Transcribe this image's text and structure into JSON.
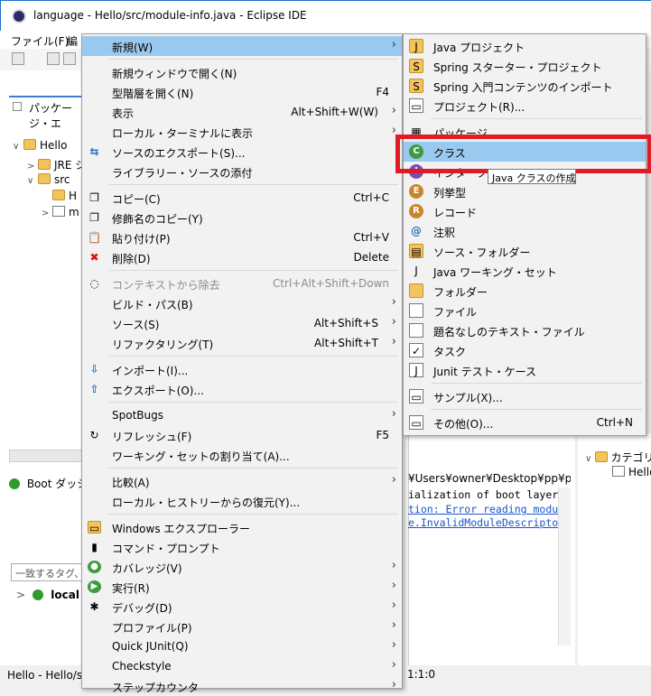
{
  "window": {
    "title": "language - Hello/src/module-info.java - Eclipse IDE"
  },
  "menubar": {
    "file": "ファイル(F)",
    "edit": "編"
  },
  "package_explorer": {
    "tab_label": "パッケージ・エ",
    "tree": [
      {
        "arrow": "∨",
        "label": "Hello"
      },
      {
        "arrow": ">",
        "label": "JRE シ"
      },
      {
        "arrow": "∨",
        "label": "src"
      },
      {
        "arrow": "",
        "label": "H"
      },
      {
        "arrow": ">",
        "label": "m"
      }
    ]
  },
  "boot_dashboard": {
    "tab_label": "Boot ダッシ",
    "filter_placeholder": "一致するタグ、",
    "local_label": "local"
  },
  "console": {
    "path": "¥Users¥owner¥Desktop¥pp¥pleiad",
    "lines": [
      "ialization of boot layer",
      "tion: Error reading modu",
      "e.InvalidModuleDescripto"
    ]
  },
  "right_panel": {
    "category": "カテゴリー",
    "item": "Hello"
  },
  "statusbar": {
    "left": "Hello - Hello/sr",
    "position": "1:1:0"
  },
  "context_menu": {
    "items": [
      {
        "label": "新規(W)",
        "shortcut": "",
        "submenu": true,
        "icon": "",
        "highlight": true
      },
      {
        "sep": true
      },
      {
        "label": "新規ウィンドウで開く(N)",
        "shortcut": "",
        "submenu": false,
        "icon": ""
      },
      {
        "label": "型階層を開く(N)",
        "shortcut": "F4",
        "submenu": false,
        "icon": ""
      },
      {
        "label": "表示",
        "shortcut": "Alt+Shift+W(W)",
        "submenu": true,
        "icon": ""
      },
      {
        "label": "ローカル・ターミナルに表示",
        "shortcut": "",
        "submenu": true,
        "icon": ""
      },
      {
        "label": "ソースのエクスポート(S)...",
        "shortcut": "",
        "submenu": false,
        "icon": "export-source-icon"
      },
      {
        "label": "ライブラリー・ソースの添付",
        "shortcut": "",
        "submenu": false,
        "icon": ""
      },
      {
        "sep": true
      },
      {
        "label": "コピー(C)",
        "shortcut": "Ctrl+C",
        "submenu": false,
        "icon": "copy-icon"
      },
      {
        "label": "修飾名のコピー(Y)",
        "shortcut": "",
        "submenu": false,
        "icon": "copy-qualified-icon"
      },
      {
        "label": "貼り付け(P)",
        "shortcut": "Ctrl+V",
        "submenu": false,
        "icon": "paste-icon"
      },
      {
        "label": "削除(D)",
        "shortcut": "Delete",
        "submenu": false,
        "icon": "delete-icon"
      },
      {
        "sep": true
      },
      {
        "label": "コンテキストから除去",
        "shortcut": "Ctrl+Alt+Shift+Down",
        "submenu": false,
        "icon": "remove-context-icon",
        "disabled": true
      },
      {
        "label": "ビルド・パス(B)",
        "shortcut": "",
        "submenu": true,
        "icon": ""
      },
      {
        "label": "ソース(S)",
        "shortcut": "Alt+Shift+S",
        "submenu": true,
        "icon": ""
      },
      {
        "label": "リファクタリング(T)",
        "shortcut": "Alt+Shift+T",
        "submenu": true,
        "icon": ""
      },
      {
        "sep": true
      },
      {
        "label": "インポート(I)...",
        "shortcut": "",
        "submenu": false,
        "icon": "import-icon"
      },
      {
        "label": "エクスポート(O)...",
        "shortcut": "",
        "submenu": false,
        "icon": "export-icon"
      },
      {
        "sep": true
      },
      {
        "label": "SpotBugs",
        "shortcut": "",
        "submenu": true,
        "icon": ""
      },
      {
        "label": "リフレッシュ(F)",
        "shortcut": "F5",
        "submenu": false,
        "icon": "refresh-icon"
      },
      {
        "label": "ワーキング・セットの割り当て(A)...",
        "shortcut": "",
        "submenu": false,
        "icon": ""
      },
      {
        "sep": true
      },
      {
        "label": "比較(A)",
        "shortcut": "",
        "submenu": true,
        "icon": ""
      },
      {
        "label": "ローカル・ヒストリーからの復元(Y)...",
        "shortcut": "",
        "submenu": false,
        "icon": ""
      },
      {
        "sep": true
      },
      {
        "label": "Windows エクスプローラー",
        "shortcut": "",
        "submenu": false,
        "icon": "explorer-icon"
      },
      {
        "label": "コマンド・プロンプト",
        "shortcut": "",
        "submenu": false,
        "icon": "terminal-icon"
      },
      {
        "label": "カバレッジ(V)",
        "shortcut": "",
        "submenu": true,
        "icon": "coverage-icon"
      },
      {
        "label": "実行(R)",
        "shortcut": "",
        "submenu": true,
        "icon": "run-icon"
      },
      {
        "label": "デバッグ(D)",
        "shortcut": "",
        "submenu": true,
        "icon": "debug-icon"
      },
      {
        "label": "プロファイル(P)",
        "shortcut": "",
        "submenu": true,
        "icon": ""
      },
      {
        "label": "Quick JUnit(Q)",
        "shortcut": "",
        "submenu": true,
        "icon": ""
      },
      {
        "label": "Checkstyle",
        "shortcut": "",
        "submenu": true,
        "icon": ""
      },
      {
        "label": "ステップカウンタ",
        "shortcut": "",
        "submenu": true,
        "icon": ""
      }
    ]
  },
  "new_submenu": {
    "items": [
      {
        "label": "Java プロジェクト",
        "shortcut": "",
        "icon": "java-project-icon"
      },
      {
        "label": "Spring スターター・プロジェクト",
        "shortcut": "",
        "icon": "spring-starter-icon"
      },
      {
        "label": "Spring 入門コンテンツのインポート",
        "shortcut": "",
        "icon": "spring-import-icon"
      },
      {
        "label": "プロジェクト(R)...",
        "shortcut": "",
        "icon": "project-icon"
      },
      {
        "sep": true
      },
      {
        "label": "パッケージ",
        "shortcut": "",
        "icon": "package-icon"
      },
      {
        "label": "クラス",
        "shortcut": "",
        "icon": "class-icon",
        "highlight": true
      },
      {
        "label": "インターフェース",
        "shortcut": "",
        "icon": "interface-icon"
      },
      {
        "label": "列挙型",
        "shortcut": "",
        "icon": "enum-icon"
      },
      {
        "label": "レコード",
        "shortcut": "",
        "icon": "record-icon"
      },
      {
        "label": "注釈",
        "shortcut": "",
        "icon": "annotation-icon"
      },
      {
        "label": "ソース・フォルダー",
        "shortcut": "",
        "icon": "source-folder-icon"
      },
      {
        "label": "Java ワーキング・セット",
        "shortcut": "",
        "icon": "working-set-icon"
      },
      {
        "label": "フォルダー",
        "shortcut": "",
        "icon": "folder-icon"
      },
      {
        "label": "ファイル",
        "shortcut": "",
        "icon": "file-icon"
      },
      {
        "label": "題名なしのテキスト・ファイル",
        "shortcut": "",
        "icon": "text-file-icon"
      },
      {
        "label": "タスク",
        "shortcut": "",
        "icon": "task-icon"
      },
      {
        "label": "Junit テスト・ケース",
        "shortcut": "",
        "icon": "junit-icon"
      },
      {
        "sep": true
      },
      {
        "label": "サンプル(X)...",
        "shortcut": "",
        "icon": "sample-icon"
      },
      {
        "sep": true
      },
      {
        "label": "その他(O)...",
        "shortcut": "Ctrl+N",
        "icon": "other-icon"
      }
    ]
  },
  "tooltip": "Java クラスの作成",
  "colors": {
    "highlight": "#99c9ef",
    "annotation_box": "#e01b24"
  }
}
